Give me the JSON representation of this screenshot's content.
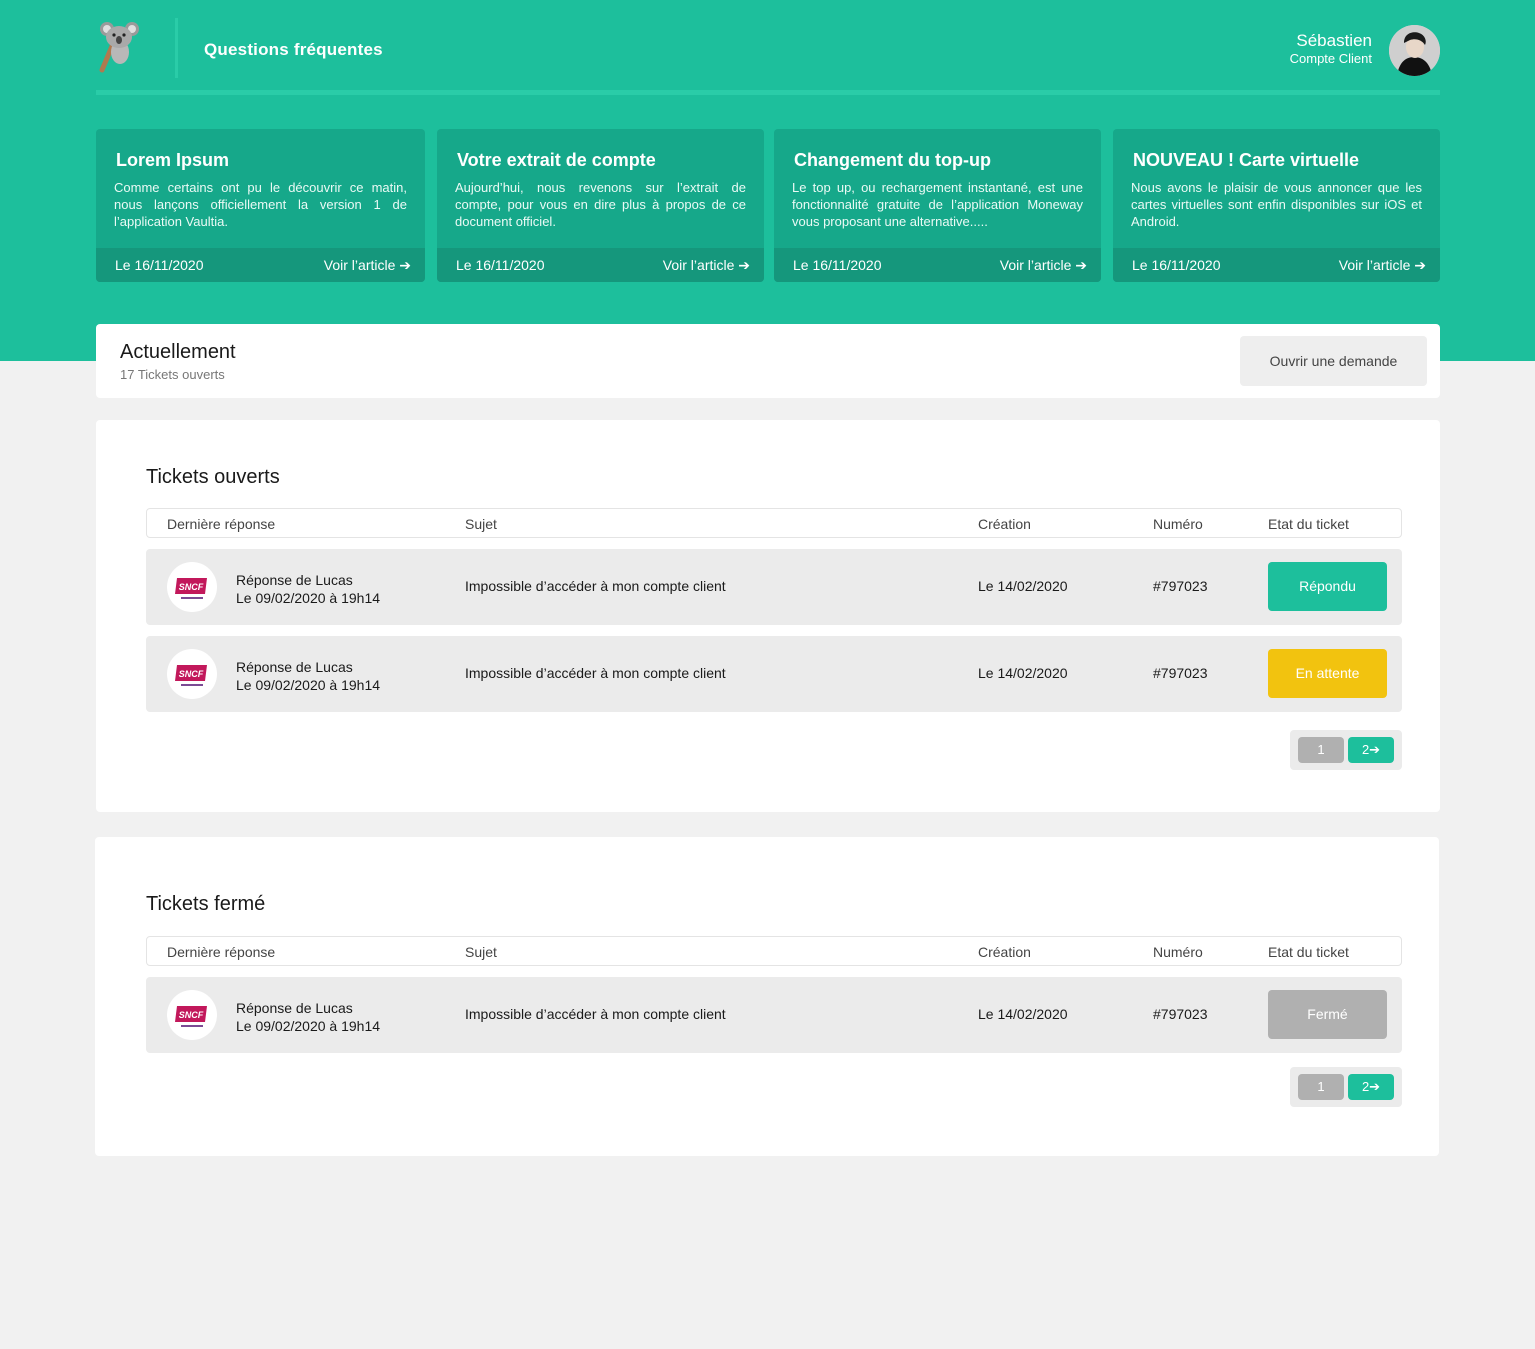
{
  "header": {
    "title": "Questions fréquentes",
    "user_name": "Sébastien",
    "user_role": "Compte Client"
  },
  "news": [
    {
      "title": "Lorem Ipsum",
      "text": "Comme certains ont pu le découvrir ce matin, nous lançons officiellement la version 1 de l’application Vaultia.",
      "date": "Le 16/11/2020",
      "link": "Voir l’article ➔"
    },
    {
      "title": "Votre extrait de compte",
      "text": "Aujourd’hui, nous revenons sur l’extrait de compte, pour vous en dire plus à propos de ce document officiel.",
      "date": "Le 16/11/2020",
      "link": "Voir l’article ➔"
    },
    {
      "title": "Changement du top-up",
      "text": "Le top up, ou rechargement instantané, est une fonctionnalité gratuite de l’application Moneway vous proposant une alternative.....",
      "date": "Le 16/11/2020",
      "link": "Voir l’article ➔"
    },
    {
      "title": "NOUVEAU ! Carte virtuelle",
      "text": "Nous avons le plaisir de vous annoncer que les cartes virtuelles sont enfin disponibles sur iOS et Android.",
      "date": "Le 16/11/2020",
      "link": "Voir l’article ➔"
    }
  ],
  "current": {
    "title": "Actuellement",
    "subtitle": "17 Tickets ouverts",
    "button": "Ouvrir une demande"
  },
  "columns": {
    "last_reply": "Dernière réponse",
    "subject": "Sujet",
    "created": "Création",
    "number": "Numéro",
    "status": "Etat du ticket"
  },
  "open_tickets": {
    "title": "Tickets ouverts",
    "rows": [
      {
        "author": "Réponse de Lucas",
        "reply_date": "Le 09/02/2020 à 19h14",
        "subject": "Impossible d’accéder à mon compte client",
        "created": "Le 14/02/2020",
        "number": "#797023",
        "status": "Répondu",
        "status_color": "#1dbf9c"
      },
      {
        "author": "Réponse de Lucas",
        "reply_date": "Le 09/02/2020 à 19h14",
        "subject": "Impossible d’accéder à mon compte client",
        "created": "Le 14/02/2020",
        "number": "#797023",
        "status": "En attente",
        "status_color": "#f2c30f"
      }
    ],
    "pager": {
      "page1": "1",
      "page2": "2➔"
    }
  },
  "closed_tickets": {
    "title": "Tickets fermé",
    "rows": [
      {
        "author": "Réponse de Lucas",
        "reply_date": "Le 09/02/2020 à 19h14",
        "subject": "Impossible d’accéder à mon compte client",
        "created": "Le 14/02/2020",
        "number": "#797023",
        "status": "Fermé",
        "status_color": "#b0b0b0"
      }
    ],
    "pager": {
      "page1": "1",
      "page2": "2➔"
    }
  },
  "icons": {
    "logo": "koala-logo-icon",
    "avatar": "user-avatar",
    "row_logo": "sncf-reseau-logo-icon"
  },
  "colors": {
    "brand": "#1dbf9c",
    "card": "#16a88a",
    "card_footer": "#15977c",
    "pending": "#f2c30f",
    "closed": "#b0b0b0"
  }
}
